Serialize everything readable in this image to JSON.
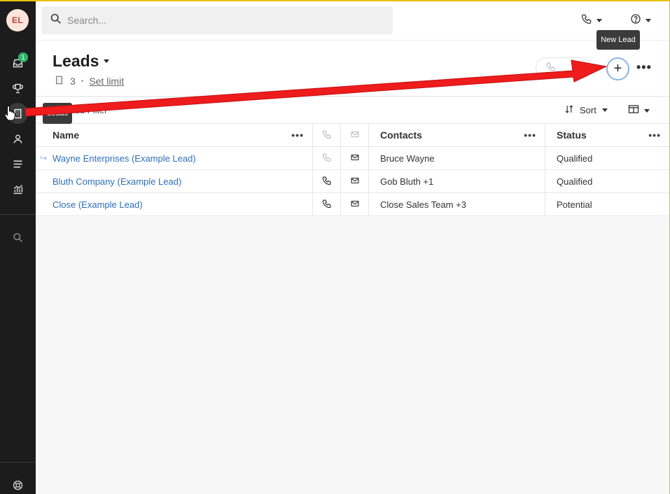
{
  "user": {
    "initials": "EL"
  },
  "sidebar": {
    "inbox_badge": "1",
    "items": [
      {
        "name": "inbox",
        "icon": "inbox-icon"
      },
      {
        "name": "opportunities",
        "icon": "trophy-icon"
      },
      {
        "name": "leads",
        "icon": "building-icon",
        "active": true
      },
      {
        "name": "contacts",
        "icon": "person-icon"
      },
      {
        "name": "smart-views",
        "icon": "list-icon"
      },
      {
        "name": "reports",
        "icon": "chart-icon"
      },
      {
        "name": "search",
        "icon": "search-icon"
      },
      {
        "name": "help",
        "icon": "lifebuoy-icon"
      }
    ],
    "tooltip": "Leads"
  },
  "topbar": {
    "search_placeholder": "Search..."
  },
  "header": {
    "title": "Leads",
    "count": "3",
    "separator": "•",
    "set_limit": "Set limit",
    "new_lead_icon": "+",
    "more": "•••",
    "tooltip": "New Lead"
  },
  "filterbar": {
    "add_filter": "Add Filter",
    "sort_label": "Sort"
  },
  "table": {
    "columns": {
      "name": "Name",
      "contacts": "Contacts",
      "status": "Status"
    },
    "col_menu": "•••",
    "rows": [
      {
        "name": "Wayne Enterprises (Example Lead)",
        "contacts": "Bruce Wayne",
        "status": "Qualified",
        "arrow": "↪"
      },
      {
        "name": "Bluth Company (Example Lead)",
        "contacts": "Gob Bluth +1",
        "status": "Qualified"
      },
      {
        "name": "Close (Example Lead)",
        "contacts": "Close Sales Team +3",
        "status": "Potential"
      }
    ]
  },
  "colors": {
    "accent_link": "#2d6fba",
    "annotation_arrow": "#ee1c1c",
    "badge": "#2fb36b",
    "sidebar_bg": "#1c1c1c"
  }
}
